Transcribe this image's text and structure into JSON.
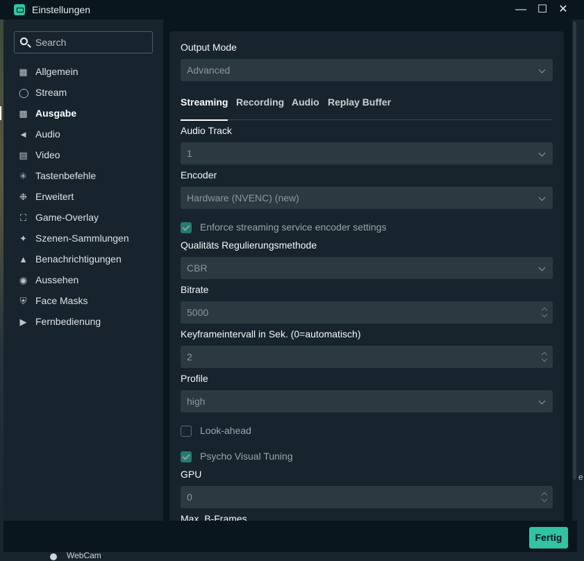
{
  "window": {
    "title": "Einstellungen"
  },
  "search": {
    "placeholder": "Search"
  },
  "sidebar": {
    "items": [
      {
        "label": "Allgemein",
        "icon": "grid-icon"
      },
      {
        "label": "Stream",
        "icon": "globe-icon"
      },
      {
        "label": "Ausgabe",
        "icon": "chip-icon",
        "active": true
      },
      {
        "label": "Audio",
        "icon": "speaker-icon"
      },
      {
        "label": "Video",
        "icon": "film-icon"
      },
      {
        "label": "Tastenbefehle",
        "icon": "gear-icon"
      },
      {
        "label": "Erweitert",
        "icon": "gears-icon"
      },
      {
        "label": "Game-Overlay",
        "icon": "expand-icon"
      },
      {
        "label": "Szenen-Sammlungen",
        "icon": "wand-icon"
      },
      {
        "label": "Benachrichtigungen",
        "icon": "bell-icon"
      },
      {
        "label": "Aussehen",
        "icon": "palette-icon"
      },
      {
        "label": "Face Masks",
        "icon": "mask-icon"
      },
      {
        "label": "Fernbedienung",
        "icon": "play-circle-icon"
      }
    ]
  },
  "output": {
    "mode_label": "Output Mode",
    "mode_value": "Advanced",
    "tabs": [
      {
        "label": "Streaming",
        "active": true
      },
      {
        "label": "Recording"
      },
      {
        "label": "Audio"
      },
      {
        "label": "Replay Buffer"
      }
    ],
    "audio_track_label": "Audio Track",
    "audio_track_value": "1",
    "encoder_label": "Encoder",
    "encoder_value": "Hardware (NVENC) (new)",
    "enforce_label": "Enforce streaming service encoder settings",
    "enforce_checked": true,
    "rate_control_label": "Qualitäts Regulierungsmethode",
    "rate_control_value": "CBR",
    "bitrate_label": "Bitrate",
    "bitrate_value": "5000",
    "keyframe_label": "Keyframeintervall in Sek. (0=automatisch)",
    "keyframe_value": "2",
    "profile_label": "Profile",
    "profile_value": "high",
    "lookahead_label": "Look-ahead",
    "lookahead_checked": false,
    "psycho_label": "Psycho Visual Tuning",
    "psycho_checked": true,
    "gpu_label": "GPU",
    "gpu_value": "0",
    "bframes_label": "Max. B-Frames"
  },
  "footer": {
    "done_label": "Fertig"
  },
  "background": {
    "webcam_label": "WebCam",
    "right_edge_text": "e"
  },
  "colors": {
    "accent": "#31c3a2",
    "panel": "#17242d",
    "window": "#09161d",
    "input": "#2b3941"
  }
}
